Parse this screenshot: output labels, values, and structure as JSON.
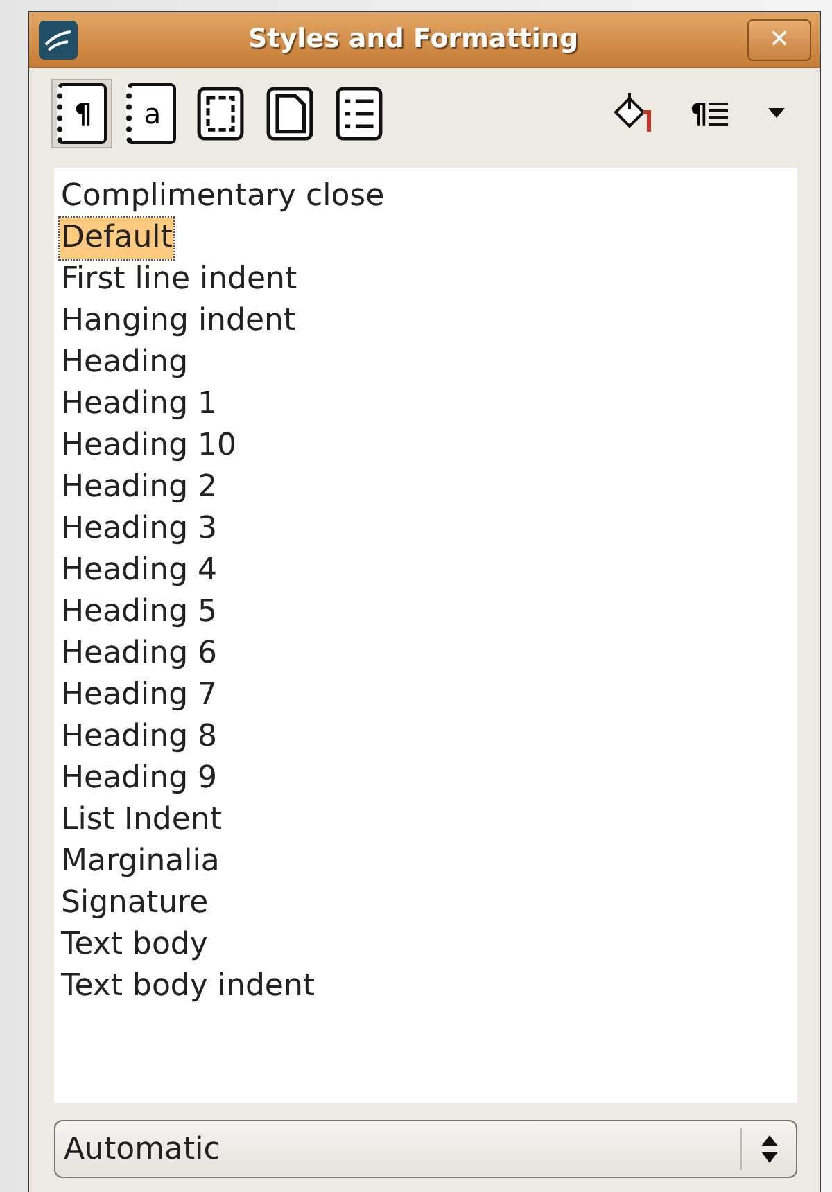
{
  "window": {
    "title": "Styles and Formatting",
    "close_glyph": "✕"
  },
  "toolbar": {
    "categories": [
      {
        "kind": "paragraph",
        "glyph": "¶",
        "selected": true
      },
      {
        "kind": "character",
        "glyph": "a",
        "selected": false
      },
      {
        "kind": "frame",
        "selected": false
      },
      {
        "kind": "page",
        "selected": false
      },
      {
        "kind": "list",
        "selected": false
      }
    ],
    "new_style_glyph": "¶"
  },
  "styles": [
    {
      "label": "Complimentary close",
      "selected": false
    },
    {
      "label": "Default",
      "selected": true
    },
    {
      "label": "First line indent",
      "selected": false
    },
    {
      "label": "Hanging indent",
      "selected": false
    },
    {
      "label": "Heading",
      "selected": false
    },
    {
      "label": "Heading 1",
      "selected": false
    },
    {
      "label": "Heading 10",
      "selected": false
    },
    {
      "label": "Heading 2",
      "selected": false
    },
    {
      "label": "Heading 3",
      "selected": false
    },
    {
      "label": "Heading 4",
      "selected": false
    },
    {
      "label": "Heading 5",
      "selected": false
    },
    {
      "label": "Heading 6",
      "selected": false
    },
    {
      "label": "Heading 7",
      "selected": false
    },
    {
      "label": "Heading 8",
      "selected": false
    },
    {
      "label": "Heading 9",
      "selected": false
    },
    {
      "label": "List Indent",
      "selected": false
    },
    {
      "label": "Marginalia",
      "selected": false
    },
    {
      "label": "Signature",
      "selected": false
    },
    {
      "label": "Text body",
      "selected": false
    },
    {
      "label": "Text body indent",
      "selected": false
    }
  ],
  "filter": {
    "value": "Automatic"
  }
}
